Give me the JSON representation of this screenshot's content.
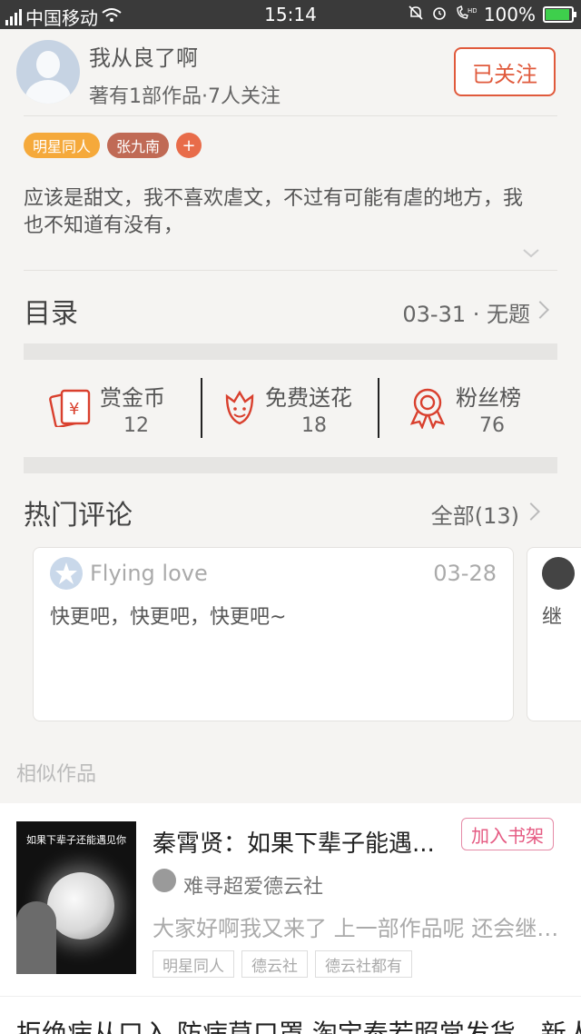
{
  "status_bar": {
    "carrier": "中国移动",
    "network": "4G",
    "time": "15:14",
    "battery": "100%"
  },
  "author": {
    "name": "我从良了啊",
    "meta": "著有1部作品·7人关注",
    "follow_label": "已关注"
  },
  "tags": [
    "明星同人",
    "张九南",
    "+"
  ],
  "description": "应该是甜文，我不喜欢虐文，不过有可能有虐的地方，我也不知道有没有，",
  "catalog": {
    "label": "目录",
    "latest": "03-31 · 无题"
  },
  "stats": [
    {
      "label": "赏金币",
      "value": "12",
      "icon": "red-envelope-icon"
    },
    {
      "label": "免费送花",
      "value": "18",
      "icon": "flower-icon"
    },
    {
      "label": "粉丝榜",
      "value": "76",
      "icon": "medal-icon"
    }
  ],
  "hot_comments": {
    "label": "热门评论",
    "all_label": "全部(13)",
    "items": [
      {
        "user": "Flying love",
        "date": "03-28",
        "text": "快更吧，快更吧，快更吧~"
      },
      {
        "text": "继"
      }
    ]
  },
  "similar": {
    "label": "相似作品",
    "book": {
      "cover_text": "如果下辈子还能遇见你",
      "title": "秦霄贤：如果下辈子能遇...",
      "shelf_label": "加入书架",
      "author": "难寻超爱德云社",
      "intro": "大家好啊我又来了 上一部作品呢 还会继续更新的",
      "tags": [
        "明星同人",
        "德云社",
        "德云社都有"
      ]
    },
    "next_line": "拒绝病从口入 防病莫口罩 淘宝泰若照常发货…新人"
  },
  "colors": {
    "accent": "#e05a3c",
    "tag_orange": "#f5a93b",
    "tag_brown": "#c06a55",
    "shelf_pink": "#e55a82"
  }
}
